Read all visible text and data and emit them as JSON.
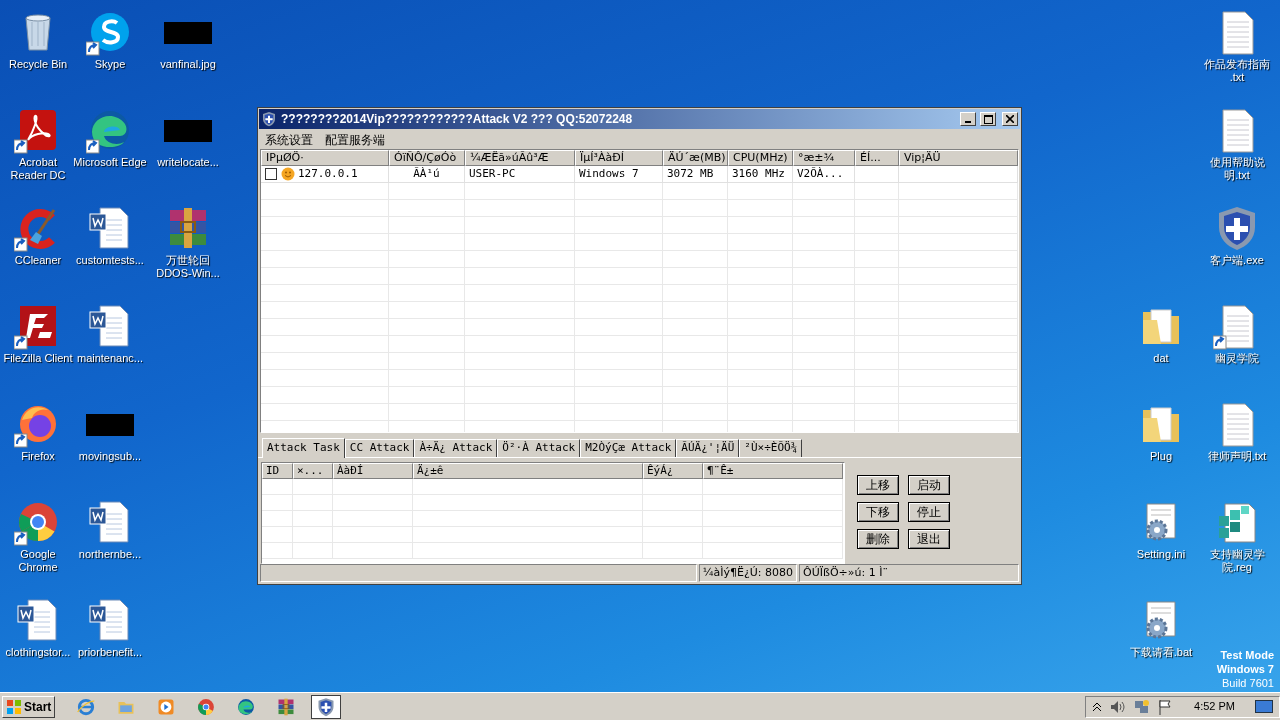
{
  "desktop": {
    "left_columns": [
      [
        {
          "label": "Recycle Bin",
          "kind": "recycle",
          "shortcut": false
        },
        {
          "label": "Acrobat Reader DC",
          "kind": "acrobat",
          "shortcut": true
        },
        {
          "label": "CCleaner",
          "kind": "ccleaner",
          "shortcut": true
        },
        {
          "label": "FileZilla Client",
          "kind": "filezilla",
          "shortcut": true
        },
        {
          "label": "Firefox",
          "kind": "firefox",
          "shortcut": true
        },
        {
          "label": "Google Chrome",
          "kind": "chrome",
          "shortcut": true
        },
        {
          "label": "clothingstor...",
          "kind": "word",
          "shortcut": false
        }
      ],
      [
        {
          "label": "Skype",
          "kind": "skype",
          "shortcut": true
        },
        {
          "label": "Microsoft Edge",
          "kind": "edge",
          "shortcut": true
        },
        {
          "label": "customtests...",
          "kind": "word",
          "shortcut": false
        },
        {
          "label": "maintenanc...",
          "kind": "word",
          "shortcut": false
        },
        {
          "label": "movingsub...",
          "kind": "hidden",
          "shortcut": false
        },
        {
          "label": "northernbe...",
          "kind": "word",
          "shortcut": false
        },
        {
          "label": "priorbenefit...",
          "kind": "word",
          "shortcut": false
        }
      ],
      [
        {
          "label": "vanfinal.jpg",
          "kind": "hidden",
          "shortcut": false
        },
        {
          "label": "writelocate...",
          "kind": "hidden",
          "shortcut": false
        },
        {
          "label": "万世轮回 DDOS-Win...",
          "kind": "winrar",
          "shortcut": false
        }
      ]
    ],
    "right_columns": [
      [
        null,
        null,
        null,
        {
          "label": "dat",
          "kind": "folder",
          "shortcut": false
        },
        {
          "label": "Plug",
          "kind": "folder",
          "shortcut": false
        },
        {
          "label": "Setting.ini",
          "kind": "ini",
          "shortcut": false
        },
        {
          "label": "下载请看.bat",
          "kind": "bat",
          "shortcut": false
        }
      ],
      [
        {
          "label": "作品发布指南 .txt",
          "kind": "txt",
          "shortcut": false
        },
        {
          "label": "使用帮助说明.txt",
          "kind": "txt",
          "shortcut": false
        },
        {
          "label": "客户端.exe",
          "kind": "shield",
          "shortcut": false
        },
        {
          "label": "幽灵学院",
          "kind": "txt",
          "shortcut": true
        },
        {
          "label": "律师声明.txt",
          "kind": "txt",
          "shortcut": false
        },
        {
          "label": "支持幽灵学院.reg",
          "kind": "reg",
          "shortcut": false
        }
      ]
    ],
    "os_notice": [
      "Test Mode",
      "Windows 7",
      "Build 7601"
    ]
  },
  "window": {
    "title": "????????2014Vip????????????Attack V2 ??? QQ:52072248",
    "menu": [
      "系统设置",
      "配置服务端"
    ],
    "hosts": {
      "columns": [
        "IPµØÖ·",
        "ÓïÑÔ/ÇøÓò",
        "¼ÆËã»úÃû³Æ",
        "ÏµÍ³ÀàÐÍ",
        "ÄÚ´æ(MB)",
        "CPU(MHz)",
        "°æ±¾",
        "ÉÍ...",
        "Vip¦ÄÜ"
      ],
      "rows": [
        {
          "checked": false,
          "cells": [
            "127.0.0.1",
            "ÃÀ¹ú",
            "USER-PC",
            "Windows 7",
            "3072 MB",
            "3160 MHz",
            "V2ÕÀ..."
          ]
        }
      ]
    },
    "tabs": [
      {
        "label": "Attack Task",
        "selected": true
      },
      {
        "label": "CC Attack",
        "selected": false
      },
      {
        "label": "À÷Ä¿ Attack",
        "selected": false
      },
      {
        "label": "Ö²·À Attack",
        "selected": false
      },
      {
        "label": "M2ÒýÇæ Attack",
        "selected": false
      },
      {
        "label": "ÃÚÄ¿'¦ÄÜ",
        "selected": false
      },
      {
        "label": "²Ù×÷ÈÕÖ¾",
        "selected": false
      }
    ],
    "tasks": {
      "columns": [
        "ID",
        "×...",
        "ÀàÐÍ",
        "Ä¿±ê",
        "ÊýÁ¿",
        "¶¨Ê±"
      ]
    },
    "buttons": [
      "上移",
      "启动",
      "下移",
      "停止",
      "删除",
      "退出"
    ],
    "status_bar": [
      "¼àÌý¶Ë¿Ú: 8080",
      "ÔÚÏßÖ÷»ú: 1 Ì¨"
    ]
  },
  "taskbar": {
    "start": "Start",
    "apps": [
      {
        "kind": "ie",
        "active": false
      },
      {
        "kind": "explorer",
        "active": false
      },
      {
        "kind": "media",
        "active": false
      },
      {
        "kind": "chrome",
        "active": false
      },
      {
        "kind": "edge",
        "active": false
      },
      {
        "kind": "winrar",
        "active": false
      },
      {
        "kind": "shield",
        "active": true
      }
    ],
    "clock": "4:52 PM"
  }
}
